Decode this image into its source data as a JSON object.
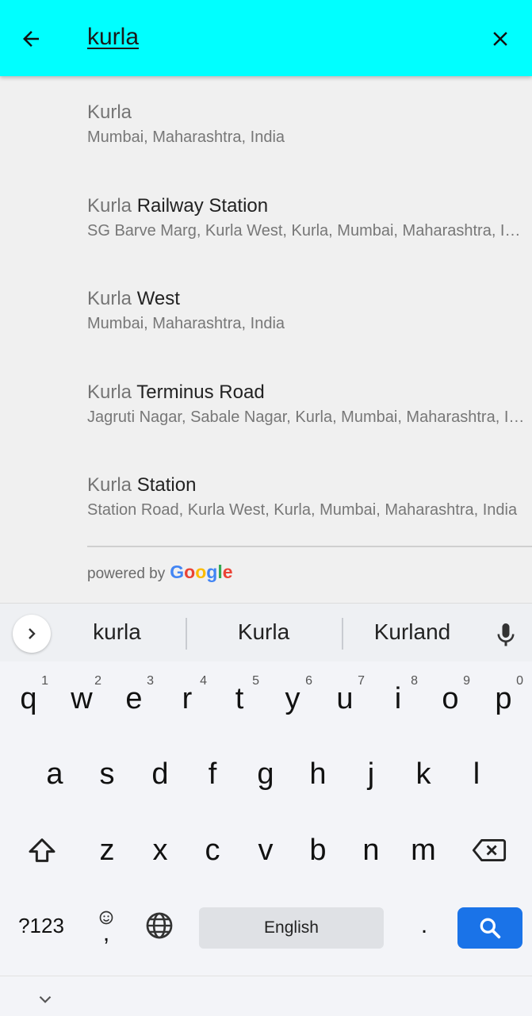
{
  "search": {
    "query": "kurla",
    "back_icon": "arrow-left-icon",
    "clear_icon": "close-icon"
  },
  "results": [
    {
      "match": "Kurla",
      "rest": "",
      "subtitle": "Mumbai, Maharashtra, India"
    },
    {
      "match": "Kurla",
      "rest": " Railway Station",
      "subtitle": "SG Barve Marg, Kurla West, Kurla, Mumbai, Maharashtra, India"
    },
    {
      "match": "Kurla",
      "rest": " West",
      "subtitle": "Mumbai, Maharashtra, India"
    },
    {
      "match": "Kurla",
      "rest": " Terminus Road",
      "subtitle": "Jagruti Nagar, Sabale Nagar, Kurla, Mumbai, Maharashtra, India"
    },
    {
      "match": "Kurla",
      "rest": " Station",
      "subtitle": "Station Road, Kurla West, Kurla, Mumbai, Maharashtra, India"
    }
  ],
  "attribution": {
    "prefix": "powered by",
    "google": [
      "G",
      "o",
      "o",
      "g",
      "l",
      "e"
    ],
    "google_colors": [
      "#4285F4",
      "#EA4335",
      "#FBBC05",
      "#4285F4",
      "#34A853",
      "#EA4335"
    ]
  },
  "suggestions": [
    "kurla",
    "Kurla",
    "Kurland"
  ],
  "keyboard": {
    "row1": [
      {
        "k": "q",
        "h": "1"
      },
      {
        "k": "w",
        "h": "2"
      },
      {
        "k": "e",
        "h": "3"
      },
      {
        "k": "r",
        "h": "4"
      },
      {
        "k": "t",
        "h": "5"
      },
      {
        "k": "y",
        "h": "6"
      },
      {
        "k": "u",
        "h": "7"
      },
      {
        "k": "i",
        "h": "8"
      },
      {
        "k": "o",
        "h": "9"
      },
      {
        "k": "p",
        "h": "0"
      }
    ],
    "row2": [
      "a",
      "s",
      "d",
      "f",
      "g",
      "h",
      "j",
      "k",
      "l"
    ],
    "row3": [
      "z",
      "x",
      "c",
      "v",
      "b",
      "n",
      "m"
    ],
    "symbols_label": "?123",
    "comma_label": ",",
    "space_label": "English",
    "period_label": ".",
    "accent_color": "#1a73e8"
  }
}
